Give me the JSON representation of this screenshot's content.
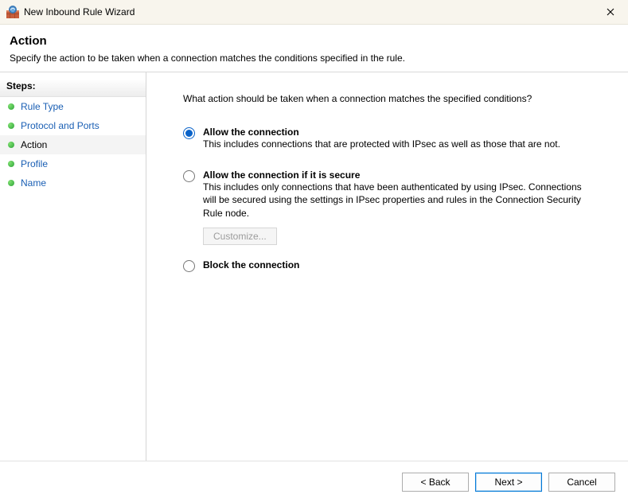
{
  "titlebar": {
    "title": "New Inbound Rule Wizard"
  },
  "header": {
    "heading": "Action",
    "subheading": "Specify the action to be taken when a connection matches the conditions specified in the rule."
  },
  "sidebar": {
    "heading": "Steps:",
    "items": [
      {
        "label": "Rule Type",
        "current": false
      },
      {
        "label": "Protocol and Ports",
        "current": false
      },
      {
        "label": "Action",
        "current": true
      },
      {
        "label": "Profile",
        "current": false
      },
      {
        "label": "Name",
        "current": false
      }
    ]
  },
  "main": {
    "prompt": "What action should be taken when a connection matches the specified conditions?",
    "options": [
      {
        "title": "Allow the connection",
        "desc": "This includes connections that are protected with IPsec as well as those that are not.",
        "selected": true
      },
      {
        "title": "Allow the connection if it is secure",
        "desc": "This includes only connections that have been authenticated by using IPsec.  Connections will be secured using the settings in IPsec properties and rules in the Connection Security Rule node.",
        "selected": false,
        "customize_label": "Customize..."
      },
      {
        "title": "Block the connection",
        "desc": "",
        "selected": false
      }
    ]
  },
  "footer": {
    "back": "< Back",
    "next": "Next >",
    "cancel": "Cancel"
  }
}
